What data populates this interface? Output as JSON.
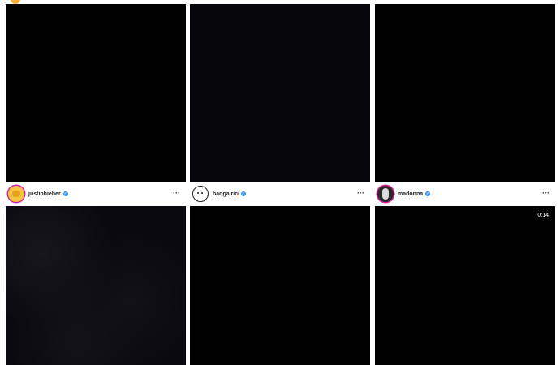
{
  "posts": [
    {
      "username": "justinbieber",
      "verified_icon": "verified-badge-icon",
      "more_label": "···"
    },
    {
      "username": "badgalriri",
      "verified_icon": "verified-badge-icon",
      "more_label": "···"
    },
    {
      "username": "madonna",
      "verified_icon": "verified-badge-icon",
      "more_label": "···",
      "video_duration": "0:14"
    }
  ],
  "colors": {
    "background": "#ffffff",
    "media_black": "#000000",
    "verified_blue": "#3897f0",
    "username_text": "#262626"
  }
}
